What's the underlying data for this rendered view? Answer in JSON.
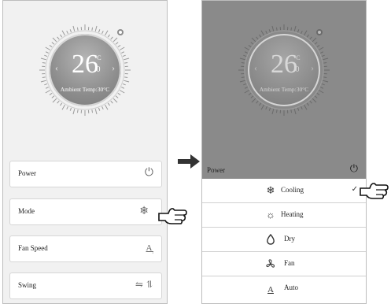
{
  "left_screen": {
    "thermostat": {
      "temperature": "26",
      "unit": "°C",
      "decimal": ".0",
      "ambient": "Ambient Temp:30°C"
    },
    "rows": [
      {
        "label": "Power",
        "icon": "power-icon"
      },
      {
        "label": "Mode",
        "icon": "snowflake-icon"
      },
      {
        "label": "Fan Speed",
        "icon": "fan-speed-auto-icon"
      },
      {
        "label": "Swing",
        "icon": "swing-icon"
      }
    ]
  },
  "right_screen": {
    "thermostat": {
      "temperature": "26",
      "unit": "°C",
      "decimal": ".0",
      "ambient": "Ambient Temp:30°C"
    },
    "power_label": "Power",
    "mode_options": [
      {
        "label": "Cooling",
        "icon": "snowflake-icon",
        "selected": true
      },
      {
        "label": "Heating",
        "icon": "sun-icon",
        "selected": false
      },
      {
        "label": "Dry",
        "icon": "droplet-icon",
        "selected": false
      },
      {
        "label": "Fan",
        "icon": "fan-icon",
        "selected": false
      },
      {
        "label": "Auto",
        "icon": "auto-icon",
        "selected": false
      }
    ]
  },
  "colors": {
    "overlay": "#8a8a8a",
    "panel": "#f1f1f1",
    "text": "#222222"
  }
}
